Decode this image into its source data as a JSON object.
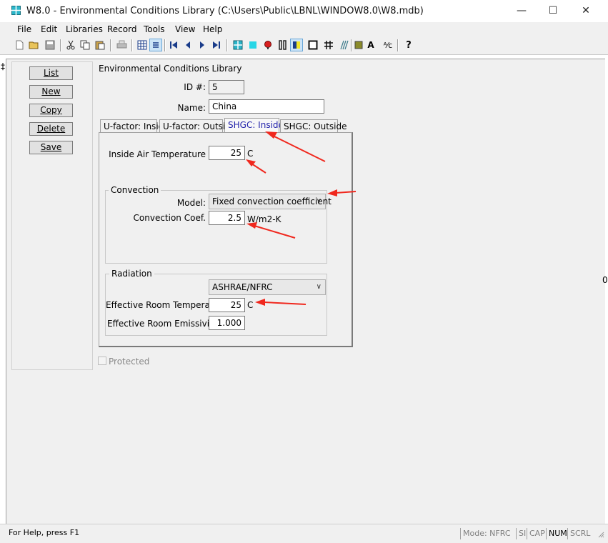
{
  "window": {
    "title": "W8.0 - Environmental Conditions Library (C:\\Users\\Public\\LBNL\\WINDOW8.0\\W8.mdb)",
    "minimize": "—",
    "maximize": "☐",
    "close": "✕"
  },
  "menu": [
    "File",
    "Edit",
    "Libraries",
    "Record",
    "Tools",
    "View",
    "Help"
  ],
  "toolbar_icons": [
    "new-icon",
    "open-icon",
    "save-icon",
    "cut-icon",
    "copy-icon",
    "paste-icon",
    "print-icon",
    "grid-view-icon",
    "list-view-icon",
    "first-record-icon",
    "previous-record-icon",
    "next-record-icon",
    "last-record-icon",
    "glazing-system-icon",
    "glass-icon",
    "gas-icon",
    "frame-icon",
    "divider-icon",
    "window-icon",
    "grid-icon",
    "shade-icon",
    "material-icon",
    "font-icon",
    "fraction-icon",
    "help-icon"
  ],
  "left_buttons": {
    "list": "List",
    "new": "New",
    "copy": "Copy",
    "delete": "Delete",
    "save": "Save"
  },
  "form": {
    "title": "Environmental Conditions Library",
    "id_label": "ID #:",
    "id_value": "5",
    "name_label": "Name:",
    "name_value": "China",
    "protected_label": "Protected",
    "protected_checked": false
  },
  "tabs": [
    "U-factor: Inside",
    "U-factor: Outside",
    "SHGC: Inside",
    "SHGC: Outside"
  ],
  "active_tab": "SHGC: Inside",
  "shgc_inside": {
    "air_temp_label": "Inside Air Temperature",
    "air_temp_value": "25",
    "air_temp_unit": "C",
    "convection": {
      "title": "Convection",
      "model_label": "Model:",
      "model_value": "Fixed convection coefficient",
      "coef_label": "Convection Coef.",
      "coef_value": "2.5",
      "coef_unit": "W/m2-K"
    },
    "radiation": {
      "title": "Radiation",
      "model_value": "ASHRAE/NFRC",
      "room_temp_label": "Effective Room Temperature",
      "room_temp_value": "25",
      "room_temp_unit": "C",
      "emissivity_label": "Effective Room Emissivity",
      "emissivity_value": "1.000"
    }
  },
  "status": {
    "help": "For Help, press F1",
    "mode": "Mode: NFRC",
    "si": "SI",
    "cap": "CAP",
    "num": "NUM",
    "scrl": "SCRL"
  },
  "colors": {
    "annotation_arrow": "#f0281e",
    "active_tab_text": "#2222aa",
    "window_bg": "#f0f0f0"
  }
}
